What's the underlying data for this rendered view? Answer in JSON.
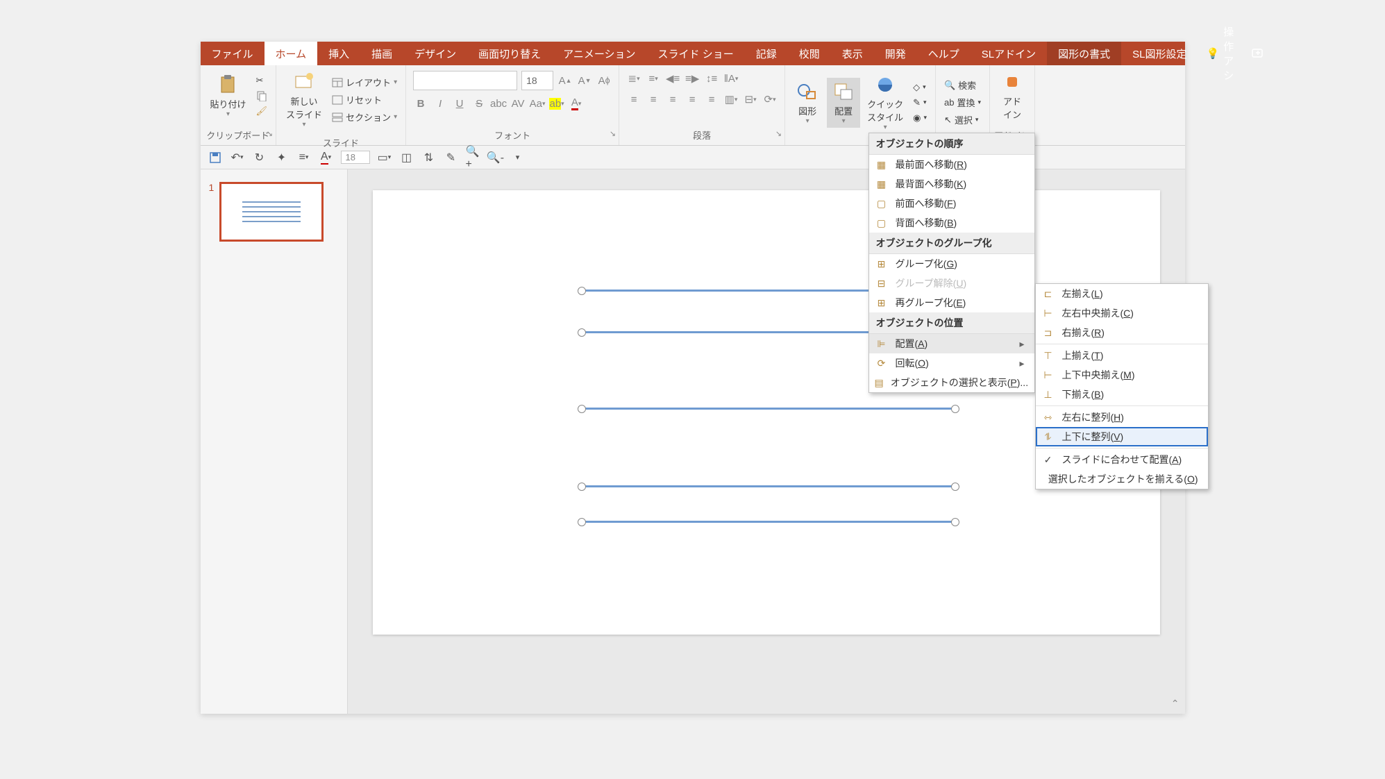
{
  "tabs": {
    "file": "ファイル",
    "home": "ホーム",
    "insert": "挿入",
    "draw": "描画",
    "design": "デザイン",
    "transitions": "画面切り替え",
    "animations": "アニメーション",
    "slideshow": "スライド ショー",
    "record": "記録",
    "review": "校閲",
    "view": "表示",
    "developer": "開発",
    "help": "ヘルプ",
    "sladdin": "SLアドイン",
    "shape_format": "図形の書式",
    "sl_shape": "SL図形設定",
    "tell_me": "操作アシ"
  },
  "ribbon": {
    "clipboard": {
      "paste": "貼り付け",
      "label": "クリップボード"
    },
    "slides": {
      "new_slide": "新しい\nスライド",
      "layout": "レイアウト",
      "reset": "リセット",
      "section": "セクション",
      "label": "スライド"
    },
    "font": {
      "size": "18",
      "label": "フォント"
    },
    "paragraph": {
      "label": "段落"
    },
    "drawing": {
      "shapes": "図形",
      "arrange": "配置",
      "quick_styles": "クイック\nスタイル"
    },
    "editing": {
      "find": "検索",
      "replace": "置換",
      "select": "選択"
    },
    "addins": {
      "addins": "アド\nイン",
      "label": "アドイン"
    }
  },
  "qat": {
    "size": "18"
  },
  "thumbnail": {
    "number": "1"
  },
  "arrange_menu": {
    "h_order": "オブジェクトの順序",
    "bring_front": "最前面へ移動(R)",
    "send_back": "最背面へ移動(K)",
    "bring_forward": "前面へ移動(F)",
    "send_backward": "背面へ移動(B)",
    "h_group": "オブジェクトのグループ化",
    "group": "グループ化(G)",
    "ungroup": "グループ解除(U)",
    "regroup": "再グループ化(E)",
    "h_position": "オブジェクトの位置",
    "align": "配置(A)",
    "rotate": "回転(O)",
    "selection_pane": "オブジェクトの選択と表示(P)..."
  },
  "align_menu": {
    "left": "左揃え(L)",
    "center_h": "左右中央揃え(C)",
    "right": "右揃え(R)",
    "top": "上揃え(T)",
    "middle_v": "上下中央揃え(M)",
    "bottom": "下揃え(B)",
    "dist_h": "左右に整列(H)",
    "dist_v": "上下に整列(V)",
    "to_slide": "スライドに合わせて配置(A)",
    "to_selected": "選択したオブジェクトを揃える(O)"
  }
}
